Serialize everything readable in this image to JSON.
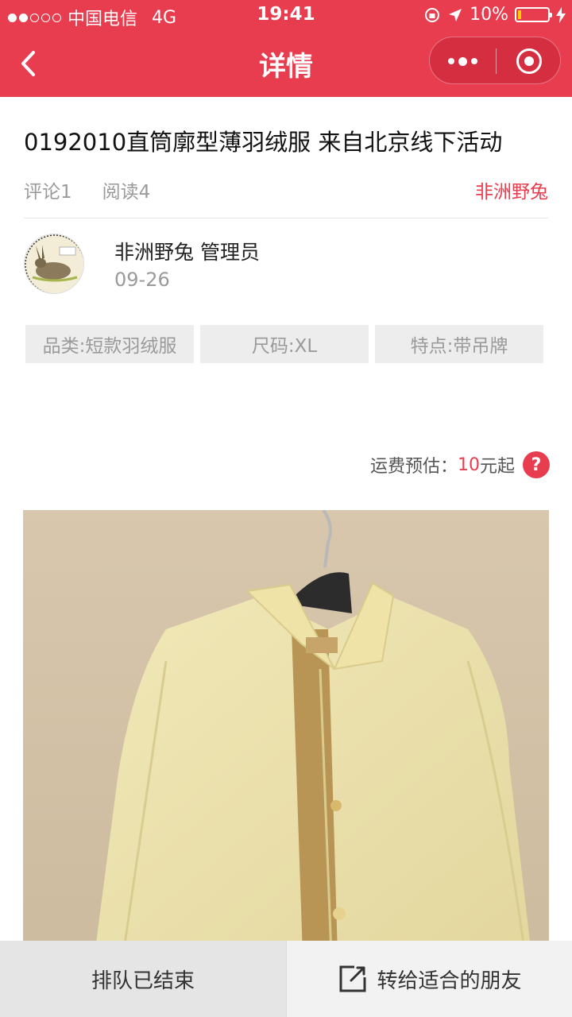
{
  "status_bar": {
    "carrier": "中国电信",
    "network": "4G",
    "time": "19:41",
    "battery": "10%",
    "battery_level": 0.1
  },
  "nav": {
    "title": "详情",
    "back_icon": "chevron-left-icon",
    "more_icon": "more-dots-icon",
    "close_icon": "target-circle-icon"
  },
  "post": {
    "title": "0192010直筒廓型薄羽绒服 来自北京线下活动",
    "comments": "评论1",
    "reads": "阅读4",
    "author_link": "非洲野兔"
  },
  "user": {
    "name": "非洲野兔 管理员",
    "date": "09-26"
  },
  "tags": [
    "品类:短款羽绒服",
    "尺码:XL",
    "特点:带吊牌"
  ],
  "shipping": {
    "label": "运费预估：",
    "price": "10",
    "suffix": "元起",
    "help": "?"
  },
  "bottom": {
    "queue_label": "排队已结束",
    "share_label": "转给适合的朋友"
  },
  "colors": {
    "brand": "#e83d4f",
    "tag_bg": "#ededed",
    "muted": "#9a9a9a"
  }
}
